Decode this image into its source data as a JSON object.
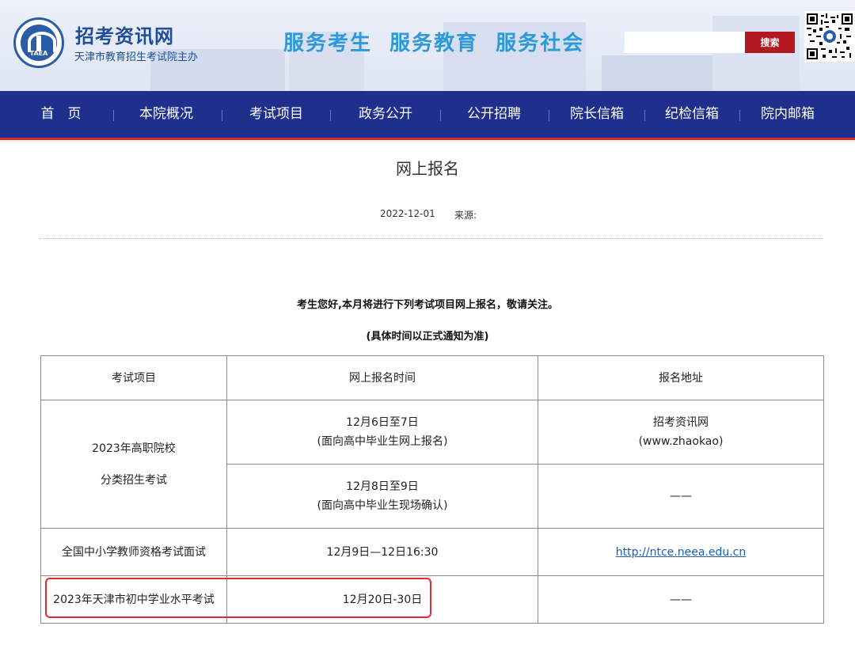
{
  "header": {
    "logo_text": "TAEA",
    "site_name": "招考资讯网",
    "site_subtitle": "天津市教育招生考试院主办",
    "slogan": "服务考生  服务教育  服务社会",
    "search": {
      "placeholder": "",
      "button_label": "搜索"
    },
    "accent_color": "#1e2f8c",
    "search_button_color": "#b3171f"
  },
  "nav": {
    "items": [
      {
        "label": "首　页"
      },
      {
        "label": "本院概况"
      },
      {
        "label": "考试项目"
      },
      {
        "label": "政务公开"
      },
      {
        "label": "公开招聘"
      },
      {
        "label": "院长信箱"
      },
      {
        "label": "纪检信箱"
      },
      {
        "label": "院内邮箱"
      }
    ]
  },
  "article": {
    "title": "网上报名",
    "date": "2022-12-01",
    "source_label": "来源:",
    "intro_line1": "考生您好,本月将进行下列考试项目网上报名，敬请关注。",
    "intro_line2": "(具体时间以正式通知为准)"
  },
  "table": {
    "headers": [
      "考试项目",
      "网上报名时间",
      "报名地址"
    ],
    "rows": [
      {
        "project_line1": "2023年高职院校",
        "project_line2": "分类招生考试",
        "sub": [
          {
            "time_line1": "12月6日至7日",
            "time_line2": "(面向高中毕业生网上报名)",
            "addr_line1": "招考资讯网",
            "addr_line2": "(www.zhaokao)"
          },
          {
            "time_line1": "12月8日至9日",
            "time_line2": "(面向高中毕业生现场确认)",
            "addr_line1": "——"
          }
        ]
      },
      {
        "project": "全国中小学教师资格考试面试",
        "time": "12月9日—12日16:30",
        "addr": "http://ntce.neea.edu.cn"
      },
      {
        "project": "2023年天津市初中学业水平考试",
        "time": "12月20日-30日",
        "addr": "——"
      }
    ]
  }
}
